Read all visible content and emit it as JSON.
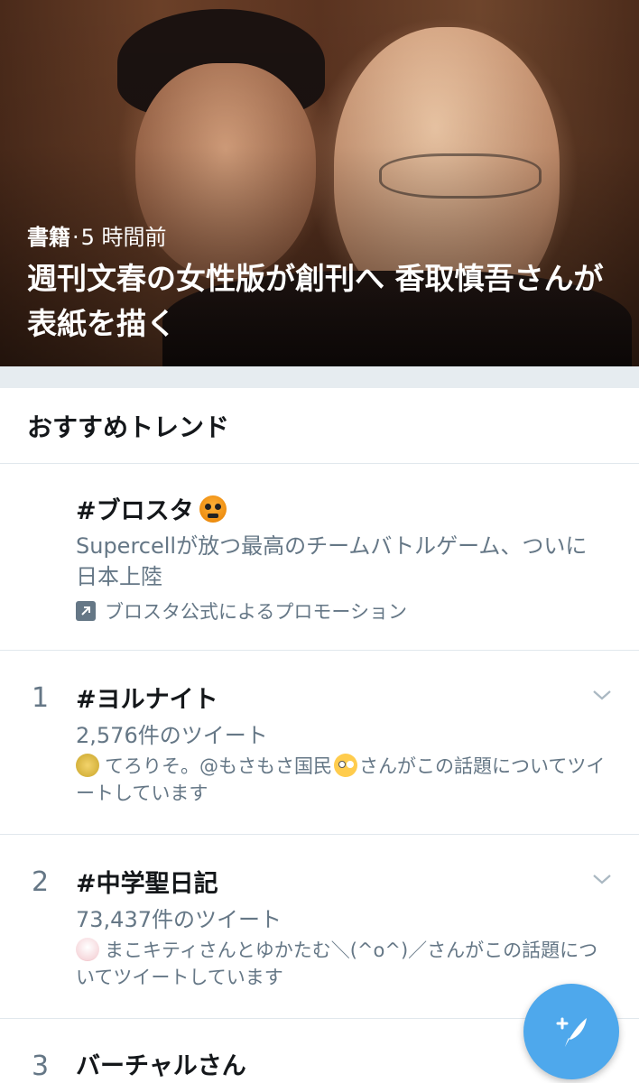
{
  "hero": {
    "category": "書籍",
    "separator": "·",
    "time": "5 時間前",
    "title": "週刊文春の女性版が創刊へ 香取慎吾さんが表紙を描く"
  },
  "section": {
    "title": "おすすめトレンド"
  },
  "promoted": {
    "name": "#ブロスタ",
    "description": "Supercellが放つ最高のチームバトルゲーム、ついに日本上陸",
    "promo_label": "ブロスタ公式によるプロモーション",
    "promo_icon": "promoted-arrow-icon"
  },
  "trends": [
    {
      "rank": "1",
      "name": "#ヨルナイト",
      "count": "2,576件のツイート",
      "context_a": "てろりそ。@もさもさ国民",
      "context_b": "さんがこの話題についてツイートしています"
    },
    {
      "rank": "2",
      "name": "#中学聖日記",
      "count": "73,437件のツイート",
      "context_a": "まこキティさんとゆかたむ＼(^o^)／さんがこの話題についてツイートしています"
    },
    {
      "rank": "3",
      "name": "バーチャルさん"
    }
  ],
  "icons": {
    "chevron": "chevron-down-icon",
    "compose": "compose-tweet-icon"
  },
  "colors": {
    "accent": "#4ea8ec",
    "secondary_text": "#657786",
    "divider": "#e6ecf0"
  }
}
